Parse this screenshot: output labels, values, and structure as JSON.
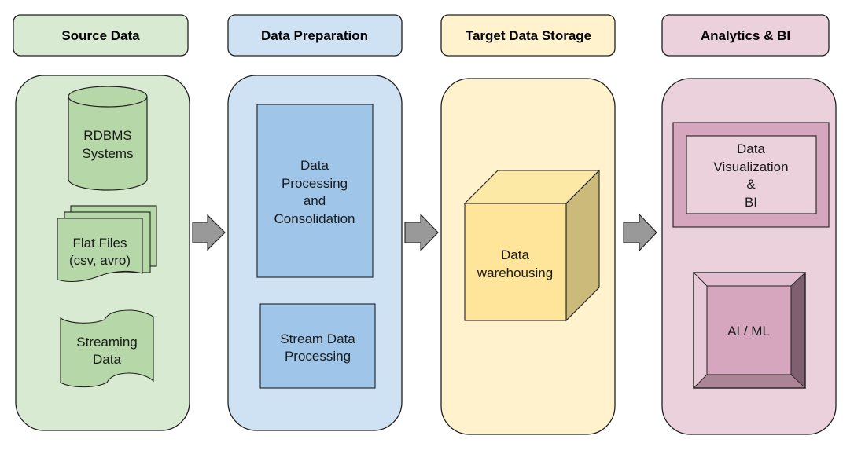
{
  "colors": {
    "green_light": "#d9ead3",
    "green_mid": "#b6d7a8",
    "blue_light": "#cfe2f3",
    "blue_mid": "#9fc5e8",
    "yellow_light": "#fff2cc",
    "yellow_mid": "#ffe599",
    "yellow_dark": "#cbba7a",
    "pink_light": "#ead1dc",
    "pink_mid": "#d5a6bd",
    "pink_dark": "#7f6070",
    "arrow": "#999999",
    "stroke": "#1f1f1f"
  },
  "stages": [
    {
      "title": "Source Data",
      "items": [
        {
          "shape": "cylinder",
          "lines": [
            "RDBMS",
            "Systems"
          ]
        },
        {
          "shape": "multi-document",
          "lines": [
            "Flat Files",
            "(csv, avro)"
          ]
        },
        {
          "shape": "tape",
          "lines": [
            "Streaming",
            "Data"
          ]
        }
      ]
    },
    {
      "title": "Data Preparation",
      "items": [
        {
          "shape": "rectangle",
          "lines": [
            "Data",
            "Processing",
            "and",
            "Consolidation"
          ]
        },
        {
          "shape": "rectangle",
          "lines": [
            "Stream Data",
            "Processing"
          ]
        }
      ]
    },
    {
      "title": "Target Data Storage",
      "items": [
        {
          "shape": "cube",
          "lines": [
            "Data",
            "warehousing"
          ]
        }
      ]
    },
    {
      "title": "Analytics & BI",
      "items": [
        {
          "shape": "framed-rectangle",
          "lines": [
            "Data",
            "Visualization",
            "&",
            "BI"
          ]
        },
        {
          "shape": "bevel",
          "lines": [
            "AI / ML"
          ]
        }
      ]
    }
  ],
  "arrows": [
    {
      "from": "Source Data",
      "to": "Data Preparation"
    },
    {
      "from": "Data Preparation",
      "to": "Target Data Storage"
    },
    {
      "from": "Target Data Storage",
      "to": "Analytics & BI"
    }
  ]
}
